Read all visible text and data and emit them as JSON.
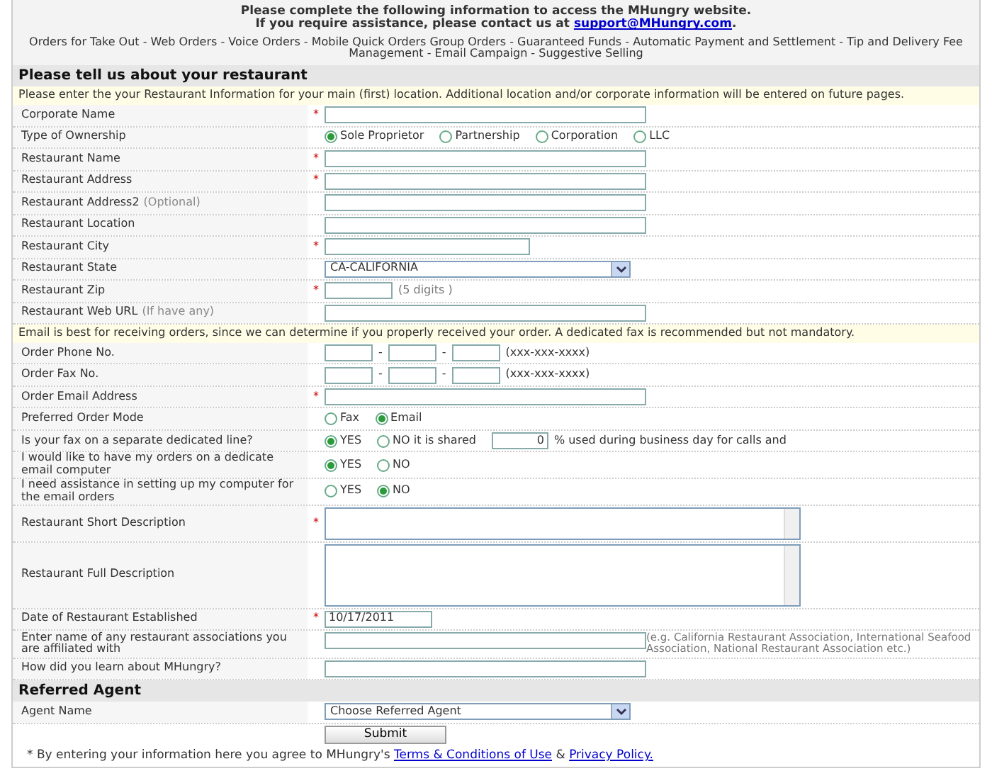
{
  "header": {
    "line_1": "Please complete the following information to access the MHungry website.",
    "line_2": "If you require assistance, please contact us at",
    "email_link": "support@MHungry.com",
    "line_2_end": ".",
    "features": "Orders for Take Out - Web Orders - Voice Orders - Mobile Quick Orders Group Orders - Guaranteed  Funds - Automatic Payment and Settlement - Tip and Delivery Fee Management - Email Campaign - Suggestive Selling"
  },
  "sections": [
    {
      "title": "Please tell us about your restaurant",
      "rows": [
        {
          "kind": "note",
          "text": "Please enter the your Restaurant Information for your main (first) location. Additional location and/or corporate information will be entered on future pages."
        },
        {
          "kind": "text",
          "label": "Corporate Name",
          "required_mark": "*"
        },
        {
          "kind": "radio",
          "label": "Type of Ownership",
          "options": [
            {
              "label": "Sole Proprietor",
              "selected": true
            },
            {
              "label": "Partnership",
              "selected": false
            },
            {
              "label": "Corporation",
              "selected": false
            },
            {
              "label": "LLC",
              "selected": false
            }
          ]
        },
        {
          "kind": "text",
          "label": "Restaurant Name",
          "required_mark": "*"
        },
        {
          "kind": "text",
          "label": "Restaurant Address",
          "required_mark": "*"
        },
        {
          "kind": "text",
          "label": "Restaurant Address2",
          "hint": "(Optional)"
        },
        {
          "kind": "text",
          "label": "Restaurant Location"
        },
        {
          "kind": "short_text",
          "label": "Restaurant City",
          "required_mark": "*"
        },
        {
          "kind": "select",
          "label": "Restaurant State",
          "value": "CA-CALIFORNIA"
        },
        {
          "kind": "zip",
          "label": "Restaurant Zip",
          "required_mark": "*",
          "after": "(5 digits )"
        },
        {
          "kind": "url",
          "label": "Restaurant Web URL",
          "hint": "(If have any)"
        },
        {
          "kind": "note",
          "text": "Email is best for receiving orders, since we can determine if you properly received your order. A dedicated fax is recommended but not mandatory."
        },
        {
          "kind": "phone",
          "label": "Order Phone No.",
          "separator": "-",
          "after": "(xxx-xxx-xxxx)"
        },
        {
          "kind": "phone",
          "label": "Order Fax No.",
          "separator": "-",
          "after": "(xxx-xxx-xxxx)"
        },
        {
          "kind": "text",
          "label": "Order Email Address",
          "required_mark": "*"
        },
        {
          "kind": "radio",
          "label": "Preferred Order Mode",
          "options": [
            {
              "label": "Fax",
              "selected": false
            },
            {
              "label": "Email",
              "selected": true
            }
          ]
        },
        {
          "kind": "radio_shared",
          "label": "Is your fax on a separate dedicated line?",
          "options": [
            {
              "label": "YES",
              "selected": true
            },
            {
              "label": "NO it is shared",
              "selected": false
            }
          ],
          "value": "0",
          "after": "% used during business day for calls  and"
        },
        {
          "kind": "radio",
          "label": "I would like to have my orders on a dedicate email computer",
          "options": [
            {
              "label": "YES",
              "selected": true
            },
            {
              "label": "NO",
              "selected": false
            }
          ]
        },
        {
          "kind": "radio",
          "label": "I need assistance in setting up my computer for the email orders",
          "options": [
            {
              "label": "YES",
              "selected": false
            },
            {
              "label": "NO",
              "selected": true
            }
          ]
        },
        {
          "kind": "textarea",
          "label": "Restaurant Short Description",
          "required_mark": "*"
        },
        {
          "kind": "textarea_large",
          "label": "Restaurant Full Description"
        },
        {
          "kind": "date",
          "label": "Date of Restaurant Established",
          "required_mark": "*",
          "value": "10/17/2011"
        },
        {
          "kind": "assoc",
          "label": "Enter name of any restaurant associations you are affiliated with",
          "after": "(e.g. California Restaurant Association, International Seafood Association, National Restaurant Association etc.)"
        },
        {
          "kind": "text",
          "label": "How did you learn about MHungry?"
        }
      ]
    },
    {
      "title": "Referred Agent",
      "rows": [
        {
          "kind": "select",
          "label": "Agent Name",
          "value": "Choose Referred Agent"
        },
        {
          "kind": "submit",
          "value": "Submit"
        }
      ]
    }
  ],
  "footer": {
    "text": "* By entering your information here you agree to MHungry's",
    "terms_link": "Terms & Conditions of Use",
    "joiner": "&",
    "privacy_link": "Privacy Policy."
  }
}
